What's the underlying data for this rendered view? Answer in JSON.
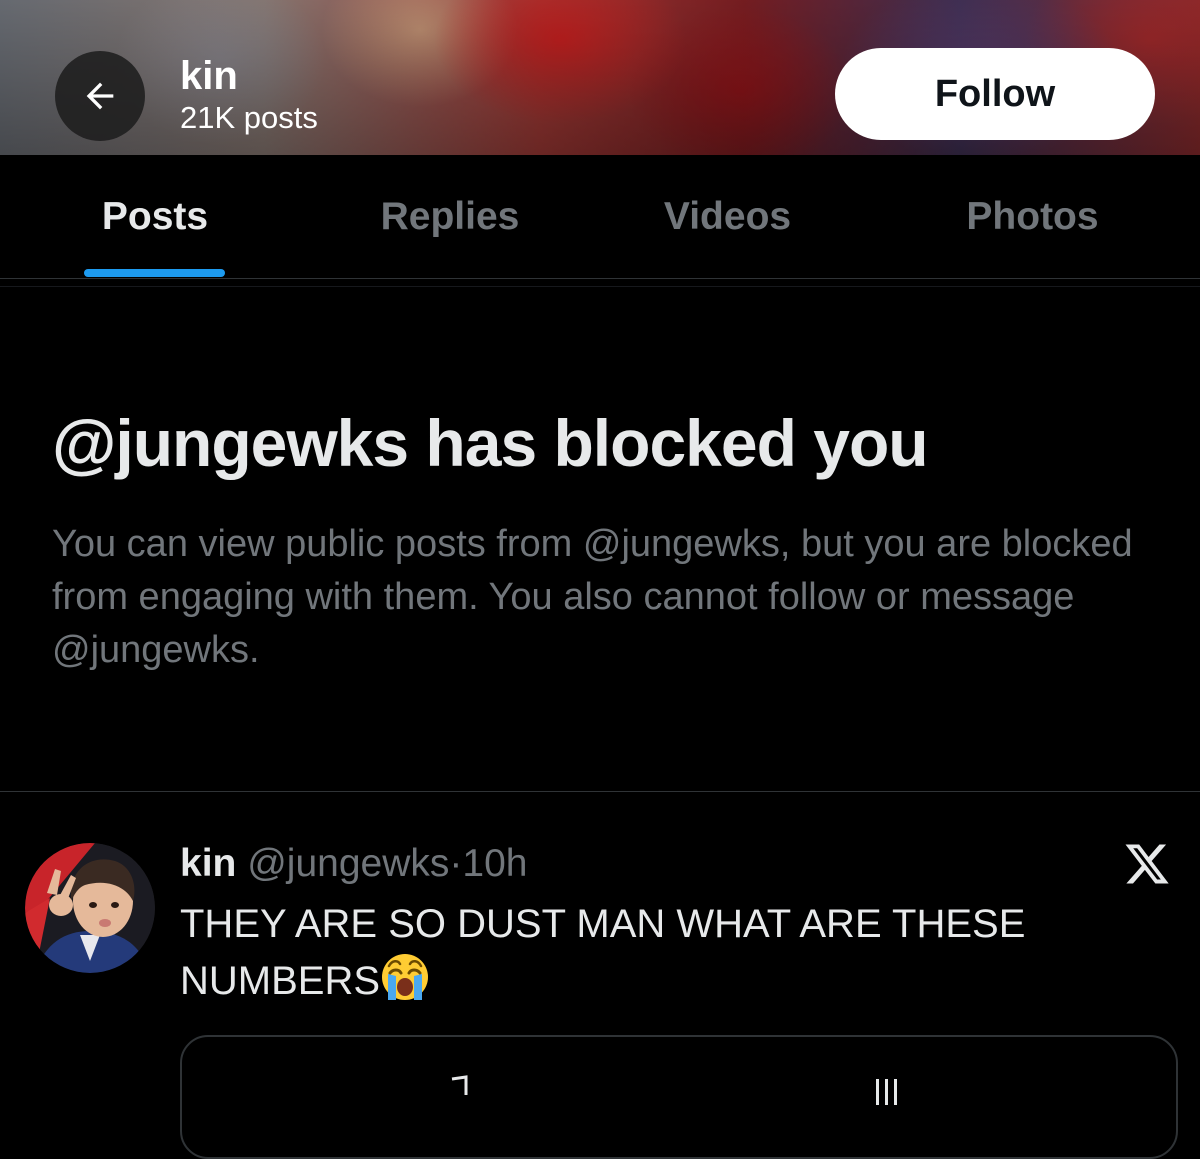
{
  "header": {
    "name": "kin",
    "post_count": "21K posts",
    "follow_label": "Follow",
    "back_icon": "arrow-left-icon"
  },
  "tabs": [
    {
      "label": "Posts",
      "active": true
    },
    {
      "label": "Replies",
      "active": false
    },
    {
      "label": "Videos",
      "active": false
    },
    {
      "label": "Photos",
      "active": false
    }
  ],
  "blocked": {
    "title": "@jungewks has blocked you",
    "description": "You can view public posts from @jungewks, but you are blocked from engaging with them. You also cannot follow or message @jungewks."
  },
  "post": {
    "display_name": "kin",
    "handle": "@jungewks",
    "separator": "·",
    "time": "10h",
    "text": "THEY ARE SO DUST MAN WHAT ARE THESE NUMBERS",
    "emoji": "crying-face-emoji",
    "platform_icon": "x-logo-icon"
  },
  "colors": {
    "background": "#000000",
    "primary_text": "#e7e9ea",
    "secondary_text": "#71767b",
    "accent": "#1d9bf0",
    "divider": "#2f3336"
  }
}
